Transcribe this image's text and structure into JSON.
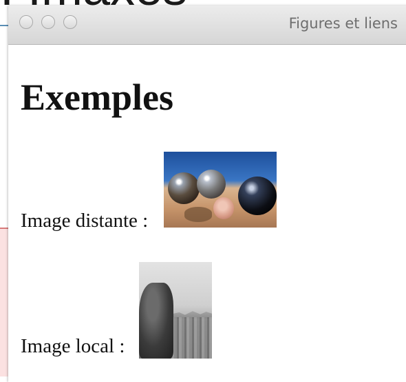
{
  "background": {
    "title_fragment": ": Imaxes"
  },
  "window": {
    "title": "Figures et liens"
  },
  "page": {
    "heading": "Exemples",
    "items": [
      {
        "label": "Image distante :"
      },
      {
        "label": "Image local :"
      }
    ]
  },
  "colors": {
    "titlebar_top": "#ececec",
    "titlebar_bottom": "#d6d6d6",
    "text": "#111111",
    "title_text": "#6e6e6e"
  }
}
